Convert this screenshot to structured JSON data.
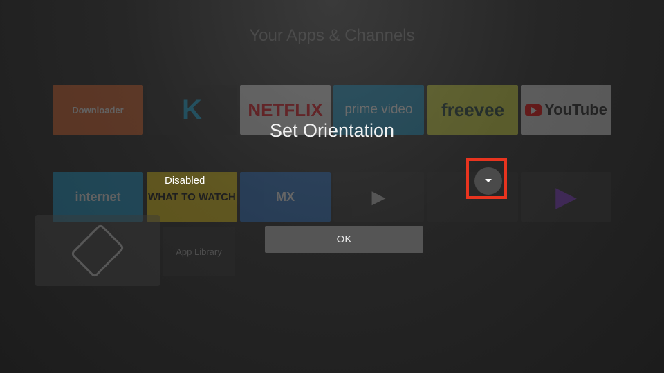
{
  "background": {
    "title": "Your Apps & Channels",
    "tiles_row1": [
      {
        "name": "downloader",
        "label": "Downloader"
      },
      {
        "name": "kodi",
        "label": "K"
      },
      {
        "name": "netflix",
        "label": "NETFLIX"
      },
      {
        "name": "prime-video",
        "label": "prime video"
      },
      {
        "name": "freevee",
        "label": "freevee"
      },
      {
        "name": "youtube",
        "label": "YouTube"
      }
    ],
    "tiles_row2": [
      {
        "name": "internet",
        "label": "internet"
      },
      {
        "name": "what-to-watch",
        "label": "WHAT TO WATCH"
      },
      {
        "name": "mx-player",
        "label": "MX"
      },
      {
        "name": "play-app",
        "label": "▶"
      },
      {
        "name": "blank-app",
        "label": ""
      },
      {
        "name": "play-circle-app",
        "label": "▶"
      }
    ],
    "app_library_label": "App Library"
  },
  "dialog": {
    "title": "Set Orientation",
    "current_value": "Disabled",
    "ok_label": "OK",
    "highlight_color": "#e8341f"
  },
  "icons": {
    "dropdown": "chevron-down-icon",
    "rotation": "screen-rotation-icon"
  }
}
